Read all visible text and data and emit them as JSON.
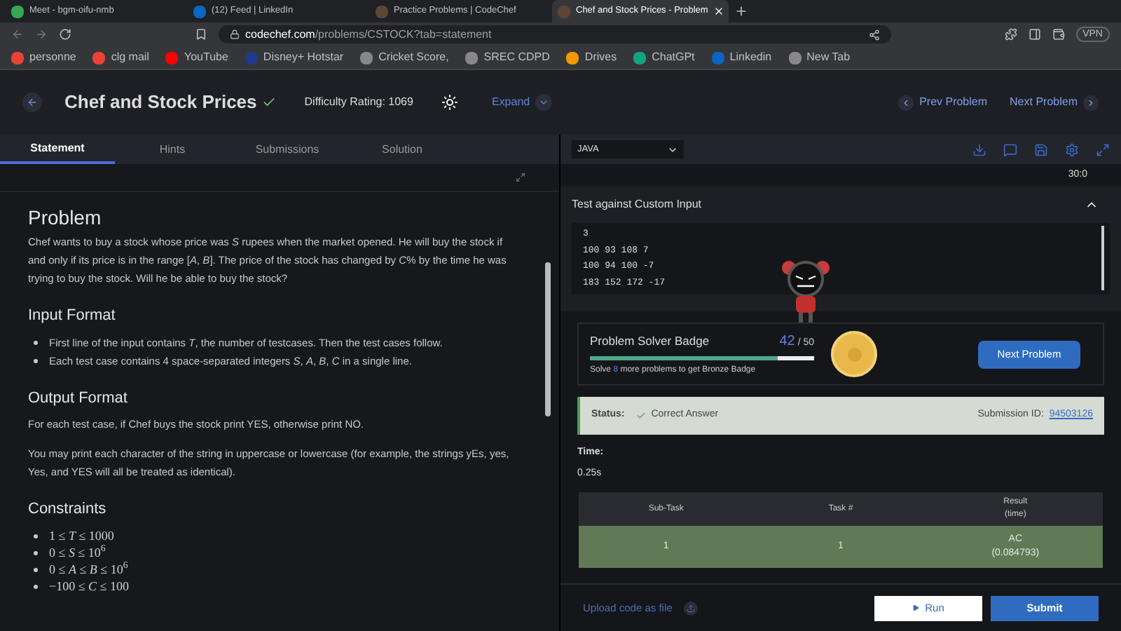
{
  "browser": {
    "tabs": [
      {
        "label": "Meet - bgm-oifu-nmb",
        "kind": "meet",
        "selected": false
      },
      {
        "label": "(12) Feed | LinkedIn",
        "kind": "linkedin",
        "selected": false
      },
      {
        "label": "Practice Problems | CodeChef",
        "kind": "cc",
        "selected": false
      },
      {
        "label": "Chef and Stock Prices - Problem",
        "kind": "cc",
        "selected": true
      }
    ],
    "url_host": "codechef.com",
    "url_path": "/problems/CSTOCK?tab=statement",
    "vpn": "VPN",
    "bookmarks": [
      {
        "label": "personne",
        "kind": "gmail"
      },
      {
        "label": "clg mail",
        "kind": "gmail"
      },
      {
        "label": "YouTube",
        "kind": "youtube"
      },
      {
        "label": "Disney+ Hotstar",
        "kind": "hotstar"
      },
      {
        "label": "Cricket Score,",
        "kind": "globe"
      },
      {
        "label": "SREC CDPD",
        "kind": "globe"
      },
      {
        "label": "Drives",
        "kind": "drive"
      },
      {
        "label": "ChatGPt",
        "kind": "chatgpt"
      },
      {
        "label": "Linkedin",
        "kind": "linkedin"
      },
      {
        "label": "New Tab",
        "kind": "globe"
      }
    ]
  },
  "header": {
    "title": "Chef and Stock Prices",
    "solved": true,
    "difficulty": "Difficulty Rating: 1069",
    "expand": "Expand",
    "prev": "Prev Problem",
    "next": "Next Problem"
  },
  "tabs": [
    {
      "label": "Statement",
      "selected": true
    },
    {
      "label": "Hints",
      "selected": false
    },
    {
      "label": "Submissions",
      "selected": false
    },
    {
      "label": "Solution",
      "selected": false
    }
  ],
  "language": "JAVA",
  "statement": [
    {
      "kind": "heading",
      "text": "Problem"
    },
    {
      "kind": "para",
      "text": "Chef wants to buy a stock whose price was *S* rupees when the market opened. He will buy the stock if and only if its price is in the range [*A*, *B*]. The price of the stock has changed by *C*% by the time he was trying to buy the stock. Will he be able to buy the stock?"
    },
    {
      "kind": "subheading",
      "text": "Input Format"
    },
    {
      "kind": "bullets",
      "items": [
        "First line of the input contains *T*, the number of testcases. Then the test cases follow.",
        "Each test case contains 4 space-separated integers *S*, *A*, *B*, *C* in a single line."
      ]
    },
    {
      "kind": "subheading",
      "text": "Output Format"
    },
    {
      "kind": "para",
      "text": "For each test case, if Chef buys the stock print YES, otherwise print NO."
    },
    {
      "kind": "para",
      "text": "You may print each character of the string in uppercase or lowercase (for example, the strings yEs, yes, Yes, and YES will all be treated as identical)."
    },
    {
      "kind": "subheading",
      "text": "Constraints"
    },
    {
      "kind": "math",
      "items": [
        "1 ≤ *T* ≤ 1000",
        "0 ≤ *S* ≤ 10$^{6}$",
        "0 ≤ *A* ≤ *B* ≤ 10$^{6}$",
        "−100 ≤ *C* ≤ 100"
      ]
    }
  ],
  "timer": "30:0",
  "custom_input": {
    "title": "Test against Custom Input",
    "expanded": true,
    "lines": [
      "3",
      "100 93 108 7",
      "100 94 100 -7",
      "183 152 172 -17"
    ]
  },
  "badge": {
    "title": "Problem Solver Badge",
    "count": "42",
    "total": "/ 50",
    "level": 0.84,
    "note_pre": "Solve",
    "note_num": "8",
    "note_post": "more problems to get Bronze Badge",
    "button": "Next Problem"
  },
  "status": {
    "label": "Status:",
    "value": "Correct Answer",
    "id_label": "Submission ID:",
    "id": "94503126"
  },
  "time": {
    "label": "Time:",
    "value": "0.25s"
  },
  "results": {
    "columns": [
      "Sub-Task",
      "Task #",
      "Result",
      "(time)"
    ],
    "rows": [
      {
        "subtask": "1",
        "task": "1",
        "result": "AC",
        "time": "(0.084793)"
      }
    ]
  },
  "footer": {
    "upload": "Upload code as file",
    "run": "Run",
    "submit": "Submit"
  }
}
